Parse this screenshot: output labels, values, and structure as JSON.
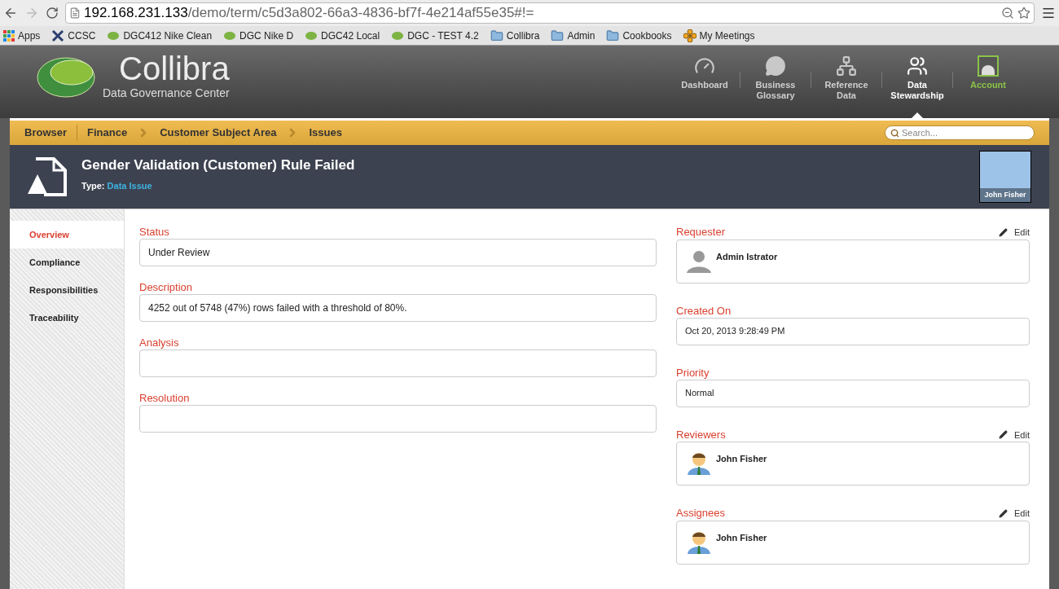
{
  "browser": {
    "url_host": "192.168.231.133",
    "url_path": "/demo/term/c5d3a802-66a3-4836-bf7f-4e214af55e35#!=",
    "bookmarks": [
      {
        "label": "Apps",
        "kind": "apps"
      },
      {
        "label": "CCSC",
        "kind": "tool"
      },
      {
        "label": "DGC412 Nike Clean",
        "kind": "leaf"
      },
      {
        "label": "DGC Nike D",
        "kind": "leaf"
      },
      {
        "label": "DGC42 Local",
        "kind": "leaf"
      },
      {
        "label": "DGC - TEST 4.2",
        "kind": "leaf"
      },
      {
        "label": "Collibra",
        "kind": "folder"
      },
      {
        "label": "Admin",
        "kind": "folder"
      },
      {
        "label": "Cookbooks",
        "kind": "folder"
      },
      {
        "label": "My Meetings",
        "kind": "flower"
      }
    ]
  },
  "header": {
    "logo": "Collibra",
    "logo_subtitle": "Data Governance Center",
    "nav": [
      {
        "label": "Dashboard",
        "kind": "dashboard",
        "selected": false
      },
      {
        "label": "Business Glossary",
        "kind": "glossary",
        "selected": false
      },
      {
        "label": "Reference Data",
        "kind": "reference",
        "selected": false
      },
      {
        "label": "Data Stewardship",
        "kind": "stewardship",
        "selected": true
      },
      {
        "label": "Account",
        "kind": "account",
        "selected": false
      }
    ]
  },
  "breadcrumb": {
    "root": "Browser",
    "items": [
      "Finance",
      "Customer Subject Area",
      "Issues"
    ],
    "search_placeholder": "Search..."
  },
  "asset": {
    "title": "Gender Validation (Customer) Rule Failed",
    "type_label": "Type:",
    "type_value": "Data Issue",
    "owner": "John Fisher"
  },
  "sidebar": [
    {
      "label": "Overview",
      "selected": true
    },
    {
      "label": "Compliance",
      "selected": false
    },
    {
      "label": "Responsibilities",
      "selected": false
    },
    {
      "label": "Traceability",
      "selected": false
    }
  ],
  "left_fields": [
    {
      "label": "Status",
      "value": "Under Review"
    },
    {
      "label": "Description",
      "value": "4252 out of 5748 (47%) rows failed with a threshold of 80%."
    },
    {
      "label": "Analysis"
    },
    {
      "label": "Resolution"
    }
  ],
  "right_fields": [
    {
      "label": "Requester",
      "kind": "silhouette_person",
      "value": "Admin Istrator",
      "edit": "Edit"
    },
    {
      "label": "Created On",
      "kind": "text",
      "value": "Oct 20, 2013 9:28:49 PM"
    },
    {
      "label": "Priority",
      "kind": "text",
      "value": "Normal"
    },
    {
      "label": "Reviewers",
      "kind": "user_person",
      "value": "John Fisher",
      "edit": "Edit"
    },
    {
      "label": "Assignees",
      "kind": "user_person",
      "value": "John Fisher",
      "edit": "Edit"
    }
  ]
}
